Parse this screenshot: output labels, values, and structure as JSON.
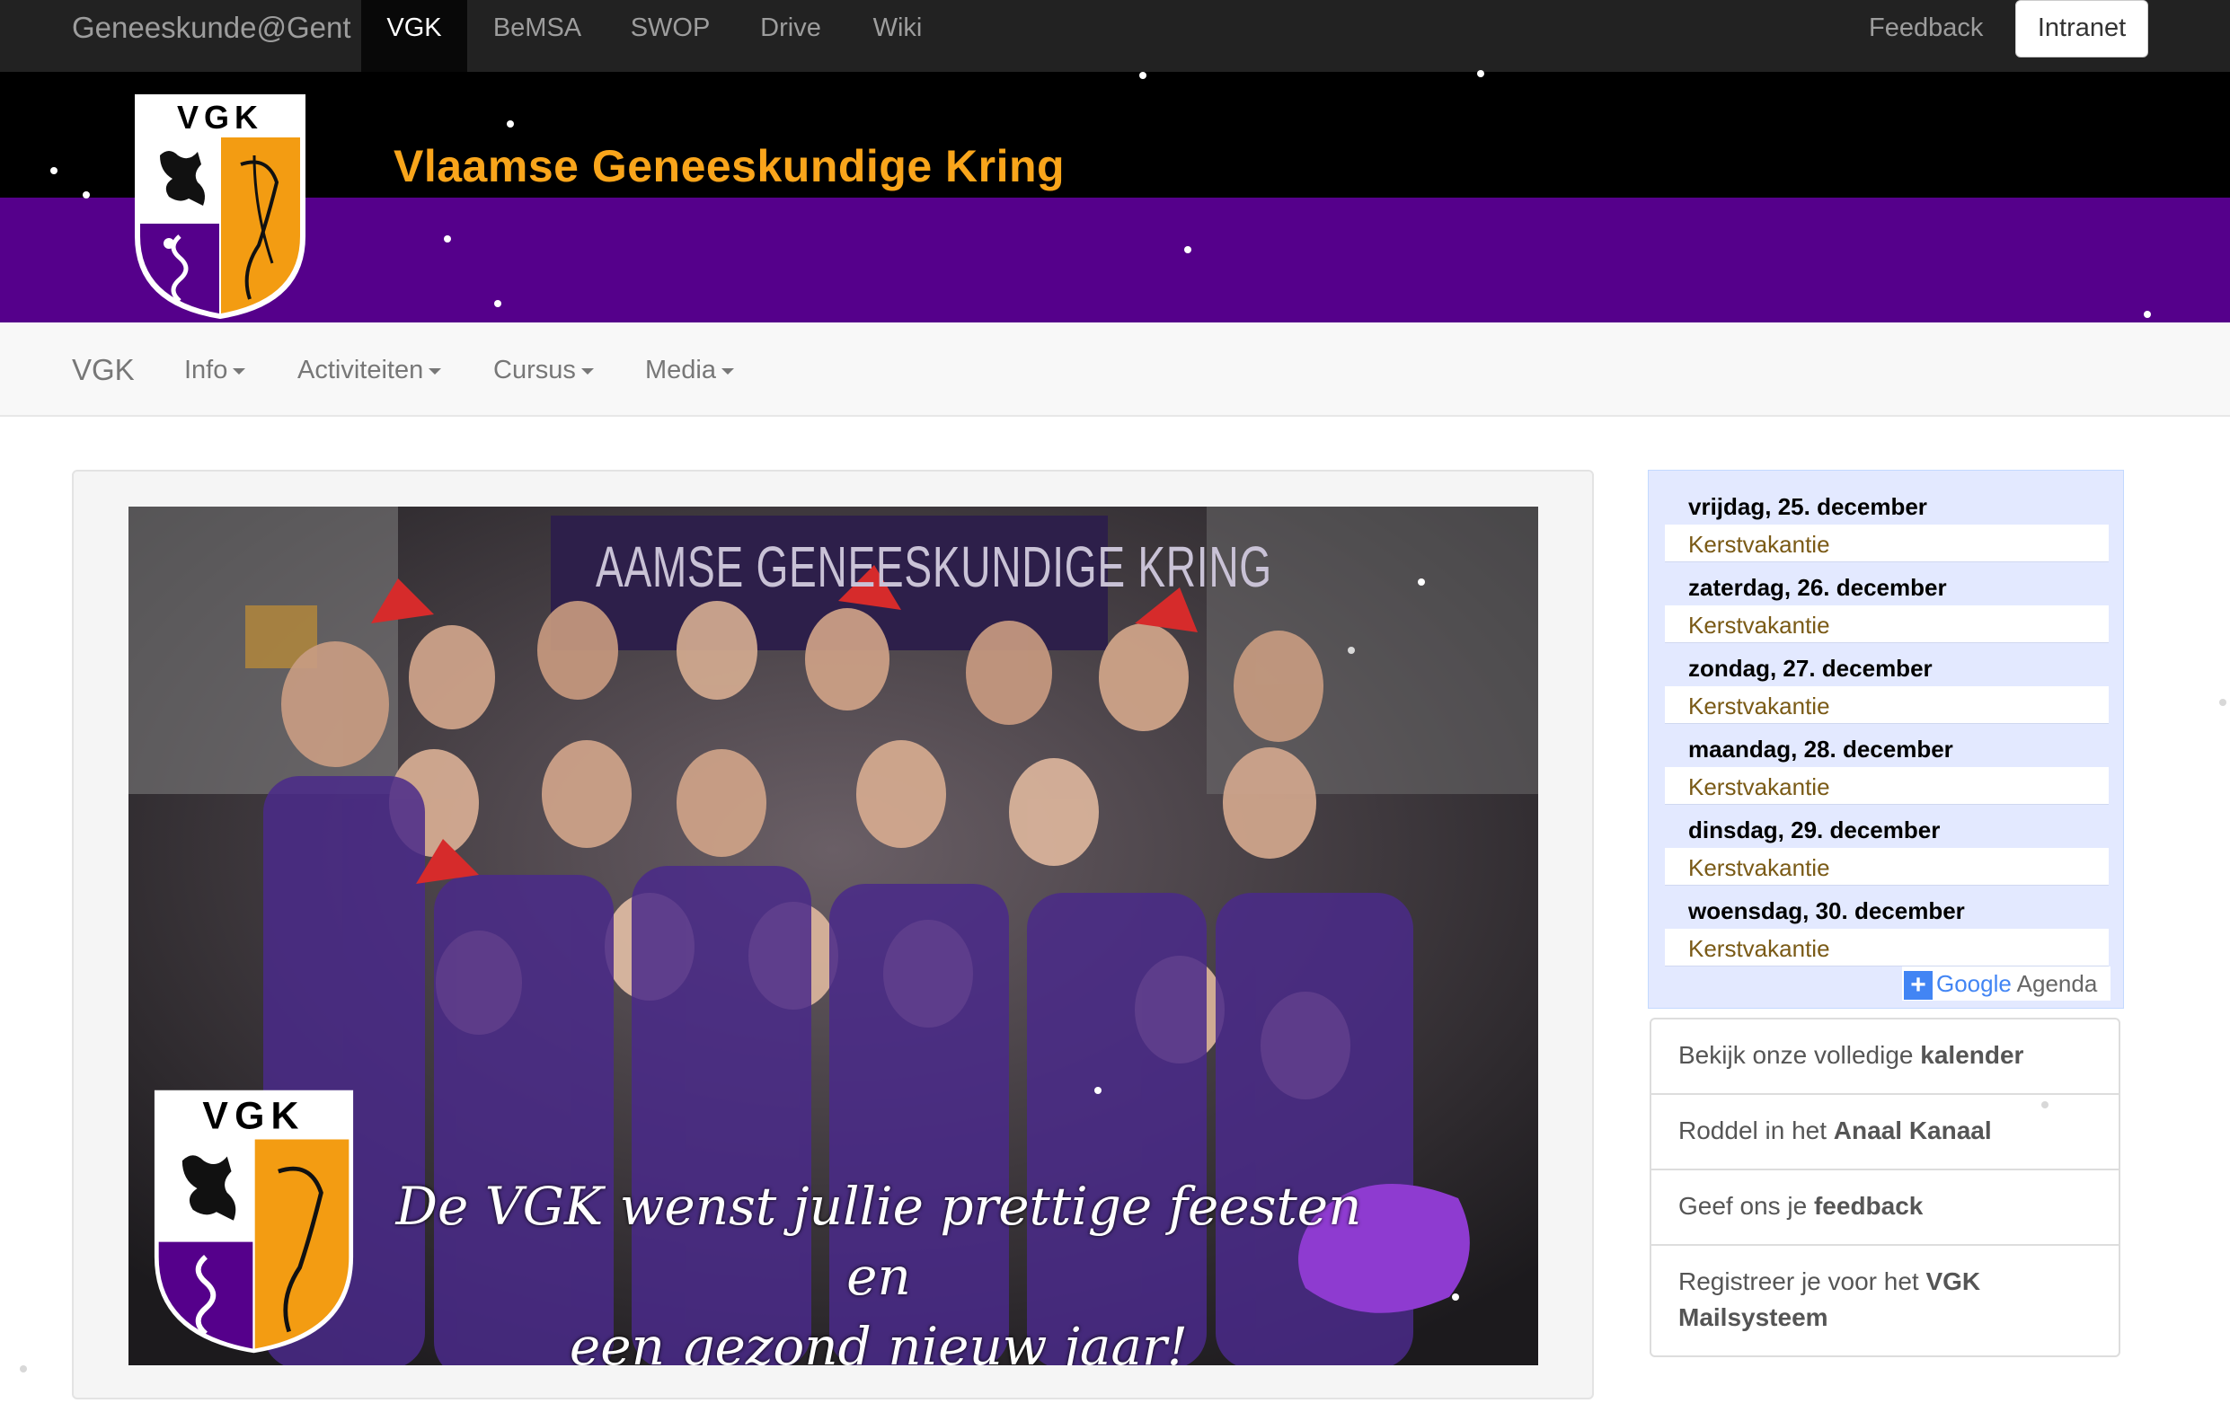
{
  "topnav": {
    "brand": "Geneeskunde@Gent",
    "tabs": [
      {
        "label": "VGK",
        "active": true
      },
      {
        "label": "BeMSA",
        "active": false
      },
      {
        "label": "SWOP",
        "active": false
      },
      {
        "label": "Drive",
        "active": false
      },
      {
        "label": "Wiki",
        "active": false
      }
    ],
    "feedback": "Feedback",
    "intranet": "Intranet"
  },
  "header": {
    "title": "Vlaamse Geneeskundige Kring",
    "logo_text": "VGK",
    "colors": {
      "title": "#f9a51b",
      "purple": "#55008b",
      "black": "#000000"
    }
  },
  "subnav": {
    "brand": "VGK",
    "items": [
      {
        "label": "Info"
      },
      {
        "label": "Activiteiten"
      },
      {
        "label": "Cursus"
      },
      {
        "label": "Media"
      }
    ]
  },
  "photo": {
    "banner_text": "AAMSE GENEESKUNDIGE KRING",
    "logo_text": "VGK",
    "caption_line1": "De VGK wenst jullie prettige feesten en",
    "caption_line2": "een gezond nieuw jaar!"
  },
  "agenda": {
    "days": [
      {
        "date": "vrijdag, 25. december",
        "event": "Kerstvakantie"
      },
      {
        "date": "zaterdag, 26. december",
        "event": "Kerstvakantie"
      },
      {
        "date": "zondag, 27. december",
        "event": "Kerstvakantie"
      },
      {
        "date": "maandag, 28. december",
        "event": "Kerstvakantie"
      },
      {
        "date": "dinsdag, 29. december",
        "event": "Kerstvakantie"
      },
      {
        "date": "woensdag, 30. december",
        "event": "Kerstvakantie"
      }
    ],
    "badge_google": "Google",
    "badge_agenda": "Agenda"
  },
  "links": [
    {
      "prefix": "Bekijk onze volledige ",
      "bold": "kalender"
    },
    {
      "prefix": "Roddel in het ",
      "bold": "Anaal Kanaal"
    },
    {
      "prefix": "Geef ons je ",
      "bold": "feedback"
    },
    {
      "prefix": "Registreer je voor het ",
      "bold": "VGK Mailsysteem"
    }
  ]
}
